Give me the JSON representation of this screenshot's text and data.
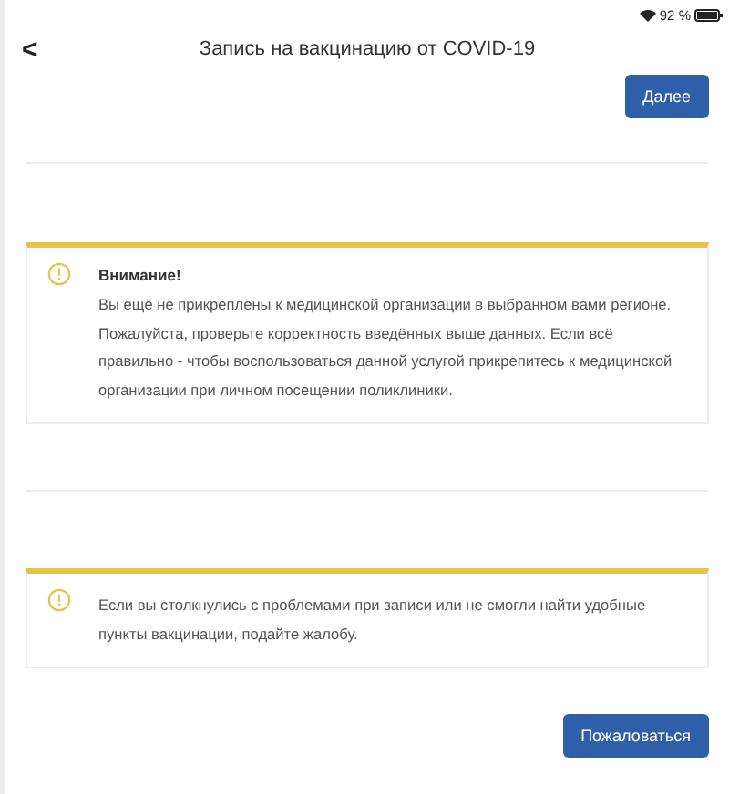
{
  "status_bar": {
    "battery": "92 %"
  },
  "header": {
    "back": "<",
    "title": "Запись на вакцинацию от COVID-19"
  },
  "next_button": "Далее",
  "alerts": [
    {
      "kind": "warning",
      "title": "Внимание!",
      "text": "Вы ещё не прикреплены к медицинской организации в выбранном вами регионе. Пожалуйста, проверьте корректность введённых выше данных. Если всё правильно - чтобы воспользоваться данной услугой прикрепитесь к медицинской организации при личном посещении поликлиники."
    },
    {
      "kind": "warning",
      "text": "Если вы столкнулись с проблемами при записи или не смогли найти удобные пункты вакцинации, подайте жалобу."
    }
  ],
  "complain_button": "Пожаловаться"
}
